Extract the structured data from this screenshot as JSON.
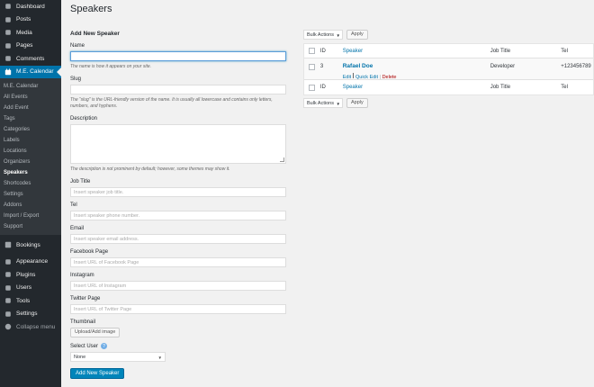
{
  "sidebar": {
    "top_items": [
      {
        "label": "Dashboard",
        "icon": "dashboard-icon"
      },
      {
        "label": "Posts",
        "icon": "pin-icon"
      },
      {
        "label": "Media",
        "icon": "media-icon"
      },
      {
        "label": "Pages",
        "icon": "pages-icon"
      },
      {
        "label": "Comments",
        "icon": "comments-icon"
      }
    ],
    "active": {
      "label": "M.E. Calendar",
      "icon": "calendar-icon"
    },
    "submenu": [
      "M.E. Calendar",
      "All Events",
      "Add Event",
      "Tags",
      "Categories",
      "Labels",
      "Locations",
      "Organizers",
      "Speakers",
      "Shortcodes",
      "Settings",
      "Addons",
      "Import / Export",
      "Support"
    ],
    "current_sub": "Speakers",
    "bookings": {
      "label": "Bookings",
      "icon": "bookings-icon"
    },
    "bottom_items": [
      {
        "label": "Appearance",
        "icon": "appearance-icon"
      },
      {
        "label": "Plugins",
        "icon": "plugins-icon"
      },
      {
        "label": "Users",
        "icon": "users-icon"
      },
      {
        "label": "Tools",
        "icon": "tools-icon"
      },
      {
        "label": "Settings",
        "icon": "settings-icon"
      }
    ],
    "collapse": {
      "label": "Collapse menu",
      "icon": "collapse-icon"
    }
  },
  "page": {
    "title": "Speakers"
  },
  "form": {
    "heading": "Add New Speaker",
    "name_label": "Name",
    "name_desc": "The name is how it appears on your site.",
    "slug_label": "Slug",
    "slug_desc": "The “slug” is the URL-friendly version of the name. It is usually all lowercase and contains only letters, numbers, and hyphens.",
    "description_label": "Description",
    "description_desc": "The description is not prominent by default; however, some themes may show it.",
    "job_title_label": "Job Title",
    "job_title_placeholder": "Insert speaker job title.",
    "tel_label": "Tel",
    "tel_placeholder": "Insert speaker phone number.",
    "email_label": "Email",
    "email_placeholder": "Insert speaker email address.",
    "facebook_label": "Facebook Page",
    "facebook_placeholder": "Insert URL of Facebook Page",
    "instagram_label": "Instagram",
    "instagram_placeholder": "Insert URL of Instagram",
    "twitter_label": "Twitter Page",
    "twitter_placeholder": "Insert URL of Twitter Page",
    "thumbnail_label": "Thumbnail",
    "upload_button": "Upload/Add image",
    "select_user_label": "Select User",
    "select_user_value": "None",
    "submit_button": "Add New Speaker"
  },
  "list": {
    "bulk_actions": "Bulk Actions",
    "apply": "Apply",
    "columns": {
      "id": "ID",
      "speaker": "Speaker",
      "job_title": "Job Title",
      "tel": "Tel"
    },
    "rows": [
      {
        "id": "3",
        "speaker": "Rafael Doe",
        "job_title": "Developer",
        "tel": "+123456789"
      }
    ],
    "row_actions": {
      "edit": "Edit",
      "quick_edit": "Quick Edit",
      "delete": "Delete",
      "sep": "|"
    }
  },
  "colors": {
    "accent": "#0073aa",
    "sidebar": "#23282d",
    "delete": "#a00"
  }
}
